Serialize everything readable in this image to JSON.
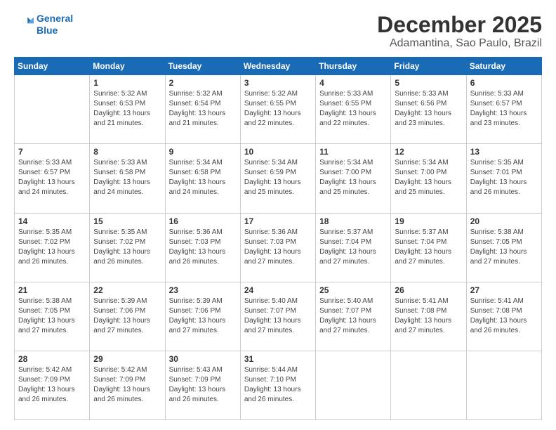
{
  "logo": {
    "line1": "General",
    "line2": "Blue"
  },
  "header": {
    "month": "December 2025",
    "location": "Adamantina, Sao Paulo, Brazil"
  },
  "days_of_week": [
    "Sunday",
    "Monday",
    "Tuesday",
    "Wednesday",
    "Thursday",
    "Friday",
    "Saturday"
  ],
  "weeks": [
    [
      {
        "day": "",
        "info": ""
      },
      {
        "day": "1",
        "info": "Sunrise: 5:32 AM\nSunset: 6:53 PM\nDaylight: 13 hours\nand 21 minutes."
      },
      {
        "day": "2",
        "info": "Sunrise: 5:32 AM\nSunset: 6:54 PM\nDaylight: 13 hours\nand 21 minutes."
      },
      {
        "day": "3",
        "info": "Sunrise: 5:32 AM\nSunset: 6:55 PM\nDaylight: 13 hours\nand 22 minutes."
      },
      {
        "day": "4",
        "info": "Sunrise: 5:33 AM\nSunset: 6:55 PM\nDaylight: 13 hours\nand 22 minutes."
      },
      {
        "day": "5",
        "info": "Sunrise: 5:33 AM\nSunset: 6:56 PM\nDaylight: 13 hours\nand 23 minutes."
      },
      {
        "day": "6",
        "info": "Sunrise: 5:33 AM\nSunset: 6:57 PM\nDaylight: 13 hours\nand 23 minutes."
      }
    ],
    [
      {
        "day": "7",
        "info": "Sunrise: 5:33 AM\nSunset: 6:57 PM\nDaylight: 13 hours\nand 24 minutes."
      },
      {
        "day": "8",
        "info": "Sunrise: 5:33 AM\nSunset: 6:58 PM\nDaylight: 13 hours\nand 24 minutes."
      },
      {
        "day": "9",
        "info": "Sunrise: 5:34 AM\nSunset: 6:58 PM\nDaylight: 13 hours\nand 24 minutes."
      },
      {
        "day": "10",
        "info": "Sunrise: 5:34 AM\nSunset: 6:59 PM\nDaylight: 13 hours\nand 25 minutes."
      },
      {
        "day": "11",
        "info": "Sunrise: 5:34 AM\nSunset: 7:00 PM\nDaylight: 13 hours\nand 25 minutes."
      },
      {
        "day": "12",
        "info": "Sunrise: 5:34 AM\nSunset: 7:00 PM\nDaylight: 13 hours\nand 25 minutes."
      },
      {
        "day": "13",
        "info": "Sunrise: 5:35 AM\nSunset: 7:01 PM\nDaylight: 13 hours\nand 26 minutes."
      }
    ],
    [
      {
        "day": "14",
        "info": "Sunrise: 5:35 AM\nSunset: 7:02 PM\nDaylight: 13 hours\nand 26 minutes."
      },
      {
        "day": "15",
        "info": "Sunrise: 5:35 AM\nSunset: 7:02 PM\nDaylight: 13 hours\nand 26 minutes."
      },
      {
        "day": "16",
        "info": "Sunrise: 5:36 AM\nSunset: 7:03 PM\nDaylight: 13 hours\nand 26 minutes."
      },
      {
        "day": "17",
        "info": "Sunrise: 5:36 AM\nSunset: 7:03 PM\nDaylight: 13 hours\nand 27 minutes."
      },
      {
        "day": "18",
        "info": "Sunrise: 5:37 AM\nSunset: 7:04 PM\nDaylight: 13 hours\nand 27 minutes."
      },
      {
        "day": "19",
        "info": "Sunrise: 5:37 AM\nSunset: 7:04 PM\nDaylight: 13 hours\nand 27 minutes."
      },
      {
        "day": "20",
        "info": "Sunrise: 5:38 AM\nSunset: 7:05 PM\nDaylight: 13 hours\nand 27 minutes."
      }
    ],
    [
      {
        "day": "21",
        "info": "Sunrise: 5:38 AM\nSunset: 7:05 PM\nDaylight: 13 hours\nand 27 minutes."
      },
      {
        "day": "22",
        "info": "Sunrise: 5:39 AM\nSunset: 7:06 PM\nDaylight: 13 hours\nand 27 minutes."
      },
      {
        "day": "23",
        "info": "Sunrise: 5:39 AM\nSunset: 7:06 PM\nDaylight: 13 hours\nand 27 minutes."
      },
      {
        "day": "24",
        "info": "Sunrise: 5:40 AM\nSunset: 7:07 PM\nDaylight: 13 hours\nand 27 minutes."
      },
      {
        "day": "25",
        "info": "Sunrise: 5:40 AM\nSunset: 7:07 PM\nDaylight: 13 hours\nand 27 minutes."
      },
      {
        "day": "26",
        "info": "Sunrise: 5:41 AM\nSunset: 7:08 PM\nDaylight: 13 hours\nand 27 minutes."
      },
      {
        "day": "27",
        "info": "Sunrise: 5:41 AM\nSunset: 7:08 PM\nDaylight: 13 hours\nand 26 minutes."
      }
    ],
    [
      {
        "day": "28",
        "info": "Sunrise: 5:42 AM\nSunset: 7:09 PM\nDaylight: 13 hours\nand 26 minutes."
      },
      {
        "day": "29",
        "info": "Sunrise: 5:42 AM\nSunset: 7:09 PM\nDaylight: 13 hours\nand 26 minutes."
      },
      {
        "day": "30",
        "info": "Sunrise: 5:43 AM\nSunset: 7:09 PM\nDaylight: 13 hours\nand 26 minutes."
      },
      {
        "day": "31",
        "info": "Sunrise: 5:44 AM\nSunset: 7:10 PM\nDaylight: 13 hours\nand 26 minutes."
      },
      {
        "day": "",
        "info": ""
      },
      {
        "day": "",
        "info": ""
      },
      {
        "day": "",
        "info": ""
      }
    ]
  ]
}
